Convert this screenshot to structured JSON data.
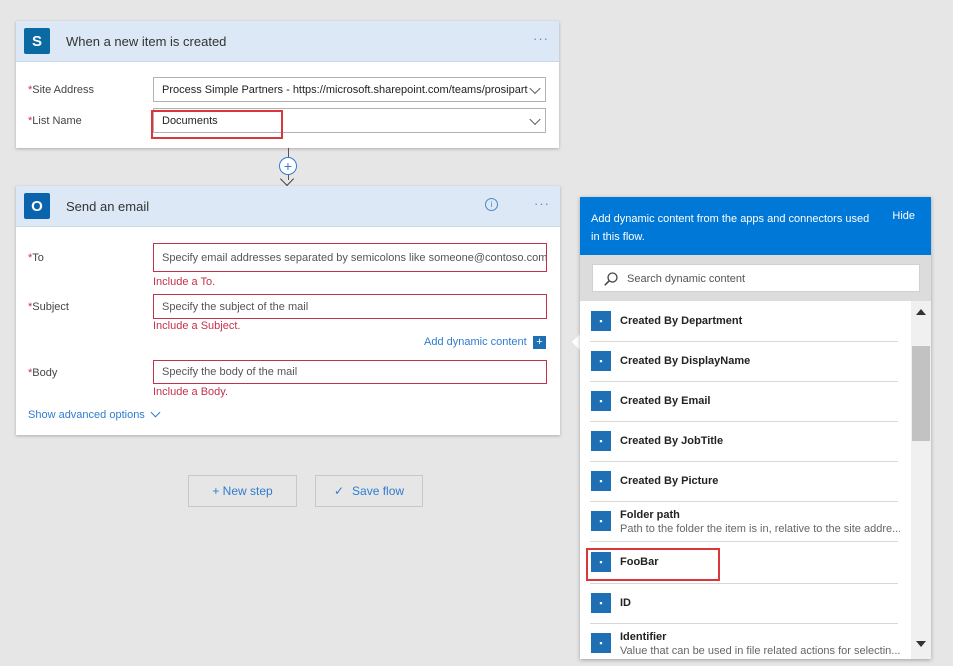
{
  "trigger": {
    "title": "When a new item is created",
    "menu": "···",
    "site_label": "Site Address",
    "site_value": "Process Simple Partners - https://microsoft.sharepoint.com/teams/prosipart",
    "list_label": "List Name",
    "list_value": "Documents"
  },
  "connector": {
    "plus": "+"
  },
  "email": {
    "title": "Send an email",
    "info": "i",
    "menu": "···",
    "to_label": "To",
    "to_placeholder": "Specify email addresses separated by semicolons like someone@contoso.com",
    "to_error": "Include a To.",
    "subject_label": "Subject",
    "subject_placeholder": "Specify the subject of the mail",
    "subject_error": "Include a Subject.",
    "dynamic_link": "Add dynamic content",
    "dynamic_badge": "+",
    "body_label": "Body",
    "body_placeholder": "Specify the body of the mail",
    "body_error": "Include a Body.",
    "advanced": "Show advanced options"
  },
  "actions": {
    "new_step": "+ New step",
    "save_flow": "Save flow",
    "save_icon": "✓"
  },
  "dynamic_panel": {
    "header": "Add dynamic content from the apps and connectors used in this flow.",
    "hide": "Hide",
    "search_placeholder": "Search dynamic content",
    "items": [
      {
        "name": "Created By Department",
        "desc": ""
      },
      {
        "name": "Created By DisplayName",
        "desc": ""
      },
      {
        "name": "Created By Email",
        "desc": ""
      },
      {
        "name": "Created By JobTitle",
        "desc": ""
      },
      {
        "name": "Created By Picture",
        "desc": ""
      },
      {
        "name": "Folder path",
        "desc": "Path to the folder the item is in, relative to the site addre..."
      },
      {
        "name": "FooBar",
        "desc": ""
      },
      {
        "name": "ID",
        "desc": ""
      },
      {
        "name": "Identifier",
        "desc": "Value that can be used in file related actions for selectin..."
      }
    ],
    "badge_glyph": "▪"
  },
  "colors": {
    "accent": "#0078d7",
    "header_bg": "#dce8f5",
    "error": "#c4314b",
    "highlight": "#d9373b",
    "canvas": "#e6e6e6"
  },
  "icons": {
    "sharepoint": "S",
    "outlook": "O",
    "search": "search-icon"
  }
}
